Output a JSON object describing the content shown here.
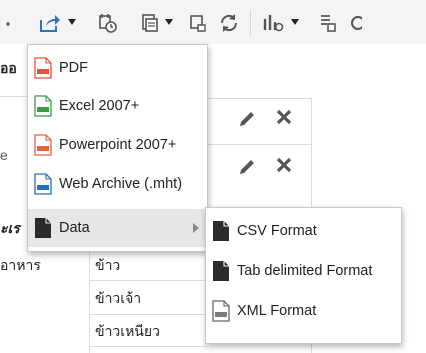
{
  "background": {
    "partial_heading": "ออ",
    "partial_label_e": "e",
    "row_header_partial": "ะเร",
    "row_label_partial": "อาหาร",
    "cells": [
      "ข้าว",
      "ข้าวเจ้า",
      "ข้าวเหนียว"
    ]
  },
  "export_menu": {
    "items": [
      {
        "label": "PDF",
        "icon": "pdf-file-icon"
      },
      {
        "label": "Excel 2007+",
        "icon": "excel-file-icon"
      },
      {
        "label": "Powerpoint 2007+",
        "icon": "powerpoint-file-icon"
      },
      {
        "label": "Web Archive (.mht)",
        "icon": "mht-file-icon"
      },
      {
        "label": "Data",
        "icon": "data-file-icon",
        "has_submenu": true,
        "highlighted": true
      }
    ]
  },
  "data_submenu": {
    "items": [
      {
        "label": "CSV Format",
        "icon": "document-icon"
      },
      {
        "label": "Tab delimited Format",
        "icon": "document-icon"
      },
      {
        "label": "XML Format",
        "icon": "xml-file-icon"
      }
    ]
  },
  "colors": {
    "menu_highlight": "#e6e6e6",
    "pdf_red": "#e8533f",
    "excel_green": "#3f9a4a",
    "powerpoint_orange": "#e2643a",
    "mht_blue": "#2a6fb8",
    "toolbar_icon_blue": "#2a74c9",
    "toolbar_bg": "#f4f4f4"
  }
}
